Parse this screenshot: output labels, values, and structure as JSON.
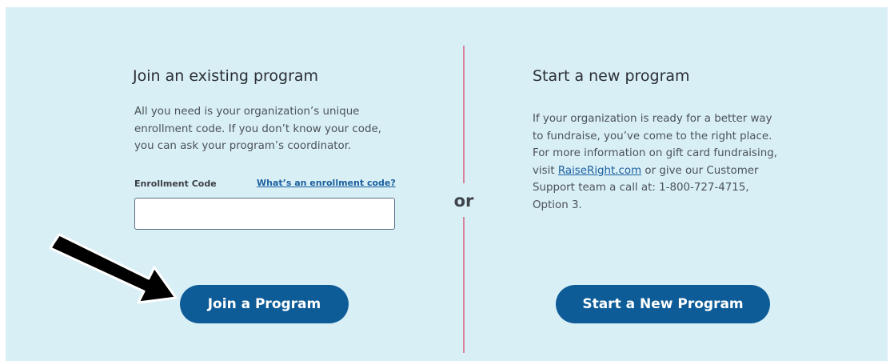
{
  "left": {
    "title": "Join an existing program",
    "description": [
      "All you need is your organization’s unique",
      "enrollment code. If you don’t know your code,",
      "you can ask your program’s coordinator."
    ],
    "enrollment_label": "Enrollment Code",
    "enrollment_help_link": "What’s an enrollment code?",
    "enrollment_value": "",
    "button_label": "Join a Program"
  },
  "divider": {
    "or_label": "or",
    "color": "#d7839e"
  },
  "right": {
    "title": "Start a new program",
    "description_lines": [
      "If your organization is ready for a better way",
      "to fundraise, you’ve come to the right place.",
      "For more information on gift card fundraising,"
    ],
    "visit_prefix": "visit ",
    "visit_link": "RaiseRight.com",
    "visit_suffix": " or give our Customer",
    "support_line": "Support team a call at: 1-800-727-4715,",
    "option_line": "Option 3.",
    "button_label": "Start a New Program"
  },
  "annotation": {
    "arrow_icon": "arrow-pointer-icon"
  },
  "colors": {
    "panel_bg": "#d9eff6",
    "button_bg": "#0d5c97",
    "link": "#1a5f9e"
  }
}
